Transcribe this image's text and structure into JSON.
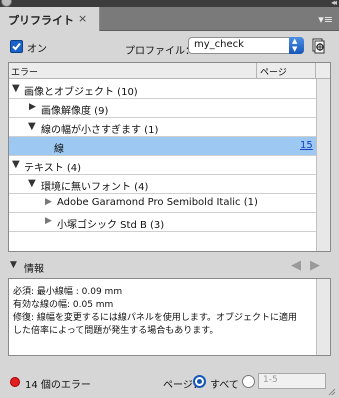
{
  "panel": {
    "tab_label": "プリフライト",
    "close_glyph": "×",
    "collapse_glyph": "◂◂"
  },
  "controls": {
    "on_label": "オン",
    "on_checked": true,
    "profile_label": "プロファイル：",
    "profile_value": "my_check"
  },
  "table": {
    "col_error": "エラー",
    "col_page": "ページ",
    "rows": [
      {
        "expanded": true,
        "label": "画像とオブジェクト (10)",
        "page": ""
      },
      {
        "expanded": false,
        "label": "画像解像度 (9)",
        "page": ""
      },
      {
        "expanded": true,
        "label": "線の幅が小さすぎます (1)",
        "page": ""
      },
      {
        "expanded": null,
        "label": "線",
        "page": "15",
        "selected": true
      },
      {
        "expanded": true,
        "label": "テキスト (4)",
        "page": ""
      },
      {
        "expanded": true,
        "label": "環境に無いフォント (4)",
        "page": ""
      },
      {
        "expanded": false,
        "label": "Adobe Garamond Pro Semibold Italic (1)",
        "page": ""
      },
      {
        "expanded": false,
        "label": "小塚ゴシック Std B (3)",
        "page": ""
      }
    ]
  },
  "info": {
    "title": "情報",
    "lines": [
      "必須: 最小線幅 : 0.09 mm",
      "有効な線の幅: 0.05 mm",
      "修復: 線幅を変更するには線パネルを使用します。オブジェクトに適用",
      "した倍率によって問題が発生する場合もあります。"
    ]
  },
  "status": {
    "error_count": "14 個のエラー",
    "pages_label": "ページ：",
    "all_label": "すべて",
    "range_placeholder": "1-5",
    "error_color": "#e02020"
  }
}
